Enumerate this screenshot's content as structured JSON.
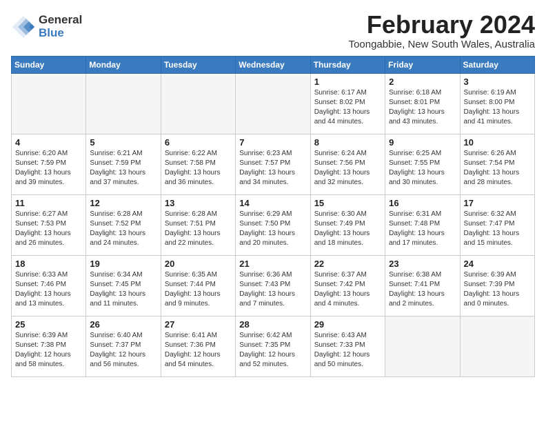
{
  "header": {
    "logo_general": "General",
    "logo_blue": "Blue",
    "month_year": "February 2024",
    "location": "Toongabbie, New South Wales, Australia"
  },
  "weekdays": [
    "Sunday",
    "Monday",
    "Tuesday",
    "Wednesday",
    "Thursday",
    "Friday",
    "Saturday"
  ],
  "weeks": [
    [
      {
        "day": "",
        "empty": true
      },
      {
        "day": "",
        "empty": true
      },
      {
        "day": "",
        "empty": true
      },
      {
        "day": "",
        "empty": true
      },
      {
        "day": "1",
        "sunrise": "6:17 AM",
        "sunset": "8:02 PM",
        "daylight": "13 hours and 44 minutes."
      },
      {
        "day": "2",
        "sunrise": "6:18 AM",
        "sunset": "8:01 PM",
        "daylight": "13 hours and 43 minutes."
      },
      {
        "day": "3",
        "sunrise": "6:19 AM",
        "sunset": "8:00 PM",
        "daylight": "13 hours and 41 minutes."
      }
    ],
    [
      {
        "day": "4",
        "sunrise": "6:20 AM",
        "sunset": "7:59 PM",
        "daylight": "13 hours and 39 minutes."
      },
      {
        "day": "5",
        "sunrise": "6:21 AM",
        "sunset": "7:59 PM",
        "daylight": "13 hours and 37 minutes."
      },
      {
        "day": "6",
        "sunrise": "6:22 AM",
        "sunset": "7:58 PM",
        "daylight": "13 hours and 36 minutes."
      },
      {
        "day": "7",
        "sunrise": "6:23 AM",
        "sunset": "7:57 PM",
        "daylight": "13 hours and 34 minutes."
      },
      {
        "day": "8",
        "sunrise": "6:24 AM",
        "sunset": "7:56 PM",
        "daylight": "13 hours and 32 minutes."
      },
      {
        "day": "9",
        "sunrise": "6:25 AM",
        "sunset": "7:55 PM",
        "daylight": "13 hours and 30 minutes."
      },
      {
        "day": "10",
        "sunrise": "6:26 AM",
        "sunset": "7:54 PM",
        "daylight": "13 hours and 28 minutes."
      }
    ],
    [
      {
        "day": "11",
        "sunrise": "6:27 AM",
        "sunset": "7:53 PM",
        "daylight": "13 hours and 26 minutes."
      },
      {
        "day": "12",
        "sunrise": "6:28 AM",
        "sunset": "7:52 PM",
        "daylight": "13 hours and 24 minutes."
      },
      {
        "day": "13",
        "sunrise": "6:28 AM",
        "sunset": "7:51 PM",
        "daylight": "13 hours and 22 minutes."
      },
      {
        "day": "14",
        "sunrise": "6:29 AM",
        "sunset": "7:50 PM",
        "daylight": "13 hours and 20 minutes."
      },
      {
        "day": "15",
        "sunrise": "6:30 AM",
        "sunset": "7:49 PM",
        "daylight": "13 hours and 18 minutes."
      },
      {
        "day": "16",
        "sunrise": "6:31 AM",
        "sunset": "7:48 PM",
        "daylight": "13 hours and 17 minutes."
      },
      {
        "day": "17",
        "sunrise": "6:32 AM",
        "sunset": "7:47 PM",
        "daylight": "13 hours and 15 minutes."
      }
    ],
    [
      {
        "day": "18",
        "sunrise": "6:33 AM",
        "sunset": "7:46 PM",
        "daylight": "13 hours and 13 minutes."
      },
      {
        "day": "19",
        "sunrise": "6:34 AM",
        "sunset": "7:45 PM",
        "daylight": "13 hours and 11 minutes."
      },
      {
        "day": "20",
        "sunrise": "6:35 AM",
        "sunset": "7:44 PM",
        "daylight": "13 hours and 9 minutes."
      },
      {
        "day": "21",
        "sunrise": "6:36 AM",
        "sunset": "7:43 PM",
        "daylight": "13 hours and 7 minutes."
      },
      {
        "day": "22",
        "sunrise": "6:37 AM",
        "sunset": "7:42 PM",
        "daylight": "13 hours and 4 minutes."
      },
      {
        "day": "23",
        "sunrise": "6:38 AM",
        "sunset": "7:41 PM",
        "daylight": "13 hours and 2 minutes."
      },
      {
        "day": "24",
        "sunrise": "6:39 AM",
        "sunset": "7:39 PM",
        "daylight": "13 hours and 0 minutes."
      }
    ],
    [
      {
        "day": "25",
        "sunrise": "6:39 AM",
        "sunset": "7:38 PM",
        "daylight": "12 hours and 58 minutes."
      },
      {
        "day": "26",
        "sunrise": "6:40 AM",
        "sunset": "7:37 PM",
        "daylight": "12 hours and 56 minutes."
      },
      {
        "day": "27",
        "sunrise": "6:41 AM",
        "sunset": "7:36 PM",
        "daylight": "12 hours and 54 minutes."
      },
      {
        "day": "28",
        "sunrise": "6:42 AM",
        "sunset": "7:35 PM",
        "daylight": "12 hours and 52 minutes."
      },
      {
        "day": "29",
        "sunrise": "6:43 AM",
        "sunset": "7:33 PM",
        "daylight": "12 hours and 50 minutes."
      },
      {
        "day": "",
        "empty": true
      },
      {
        "day": "",
        "empty": true
      }
    ]
  ]
}
